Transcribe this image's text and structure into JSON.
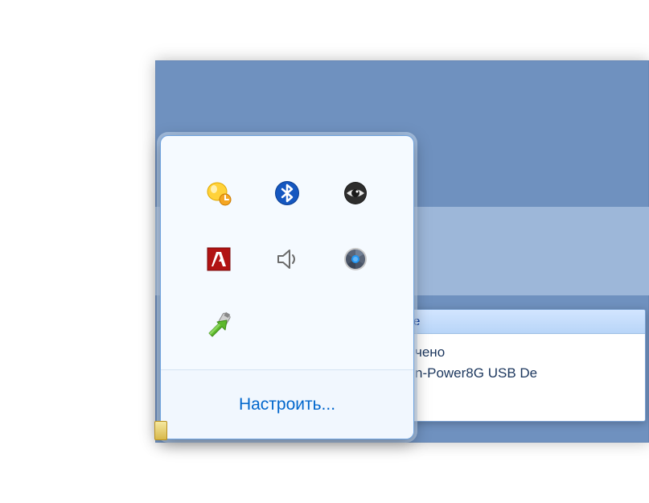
{
  "toast": {
    "title_fragment": "е",
    "line1_fragment": "чено",
    "line2_fragment": "n-Power8G USB De"
  },
  "tray": {
    "customize_label": "Настроить...",
    "icons": [
      {
        "id": "messenger-away-icon"
      },
      {
        "id": "bluetooth-icon"
      },
      {
        "id": "eye-icon"
      },
      {
        "id": "adobe-icon"
      },
      {
        "id": "volume-icon"
      },
      {
        "id": "camera-lens-icon"
      },
      {
        "id": "safely-remove-icon"
      }
    ]
  }
}
